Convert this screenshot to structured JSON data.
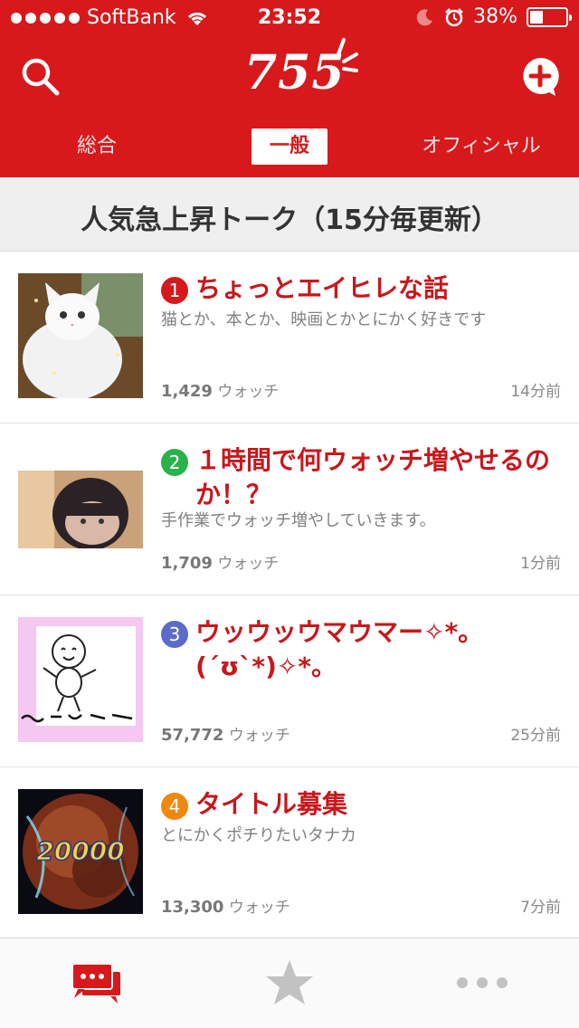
{
  "status_bar": {
    "carrier": "SoftBank",
    "time": "23:52",
    "battery": "38%",
    "battery_level": 0.38
  },
  "header": {
    "logo_text": "755",
    "icons": {
      "left": "search-icon",
      "right": "add-talk-icon"
    },
    "tabs": [
      {
        "label": "総合",
        "active": false
      },
      {
        "label": "一般",
        "active": true
      },
      {
        "label": "オフィシャル",
        "active": false
      }
    ]
  },
  "section": {
    "title": "人気急上昇トーク（15分毎更新）"
  },
  "talks": [
    {
      "rank": "1",
      "rank_color": "#d7191c",
      "title": "ちょっとエイヒレな話",
      "description": "猫とか、本とか、映画とかとにかく好きです",
      "watchers": "1,429",
      "watch_label": "ウォッチ",
      "time": "14分前"
    },
    {
      "rank": "2",
      "rank_color": "#2bb14a",
      "title": "１時間で何ウォッチ増やせるのか！？",
      "description": "手作業でウォッチ増やしていきます。",
      "watchers": "1,709",
      "watch_label": "ウォッチ",
      "time": "1分前"
    },
    {
      "rank": "3",
      "rank_color": "#5b6bc7",
      "title": "ウッウッウマウマー✧*。(´ʊ`*)✧*。",
      "description": "",
      "watchers": "57,772",
      "watch_label": "ウォッチ",
      "time": "25分前"
    },
    {
      "rank": "4",
      "rank_color": "#f0870f",
      "title": "タイトル募集",
      "description": "とにかくポチりたいタナカ",
      "watchers": "13,300",
      "watch_label": "ウォッチ",
      "time": "7分前",
      "thumb_text": "20000"
    }
  ],
  "tab_bar": {
    "items": [
      {
        "icon": "chat-bubbles-icon",
        "active": true
      },
      {
        "icon": "star-icon",
        "active": false
      },
      {
        "icon": "more-dots-icon",
        "active": false
      }
    ]
  },
  "colors": {
    "brand": "#d7191c",
    "title": "#c8171b"
  }
}
